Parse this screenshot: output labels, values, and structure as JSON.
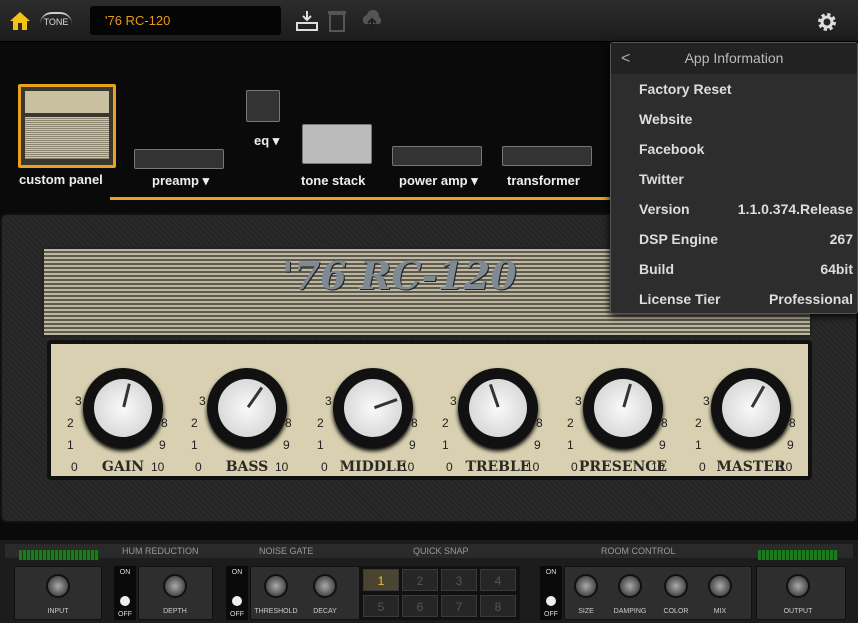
{
  "topbar": {
    "preset_name": "'76 RC-120",
    "tone_logo": "TONE",
    "icons": [
      "home-icon",
      "tonecloud-logo",
      "save-icon",
      "trash-icon",
      "cloud-upload-icon",
      "gear-icon"
    ],
    "accent": "#e9a21c"
  },
  "chain": {
    "modules": [
      {
        "label": "custom panel",
        "selected": true
      },
      {
        "label": "preamp",
        "dropdown": true
      },
      {
        "label": "eq",
        "dropdown": true
      },
      {
        "label": "tone stack"
      },
      {
        "label": "power amp",
        "dropdown": true
      },
      {
        "label": "transformer"
      }
    ]
  },
  "amp": {
    "name": "'76 RC-120",
    "scale": [
      "0",
      "1",
      "2",
      "3",
      "4",
      "5",
      "6",
      "7",
      "8",
      "9",
      "10"
    ],
    "knobs": [
      {
        "label": "GAIN",
        "value": 5.5
      },
      {
        "label": "BASS",
        "value": 6.3
      },
      {
        "label": "MIDDLE",
        "value": 7.6
      },
      {
        "label": "TREBLE",
        "value": 4.3
      },
      {
        "label": "PRESENCE",
        "value": 5.6
      },
      {
        "label": "MASTER",
        "value": 6.1
      }
    ]
  },
  "menu": {
    "title": "App Information",
    "items": [
      {
        "label": "Factory Reset",
        "value": ""
      },
      {
        "label": "Website",
        "value": ""
      },
      {
        "label": "Facebook",
        "value": ""
      },
      {
        "label": "Twitter",
        "value": ""
      },
      {
        "label": "Version",
        "value": "1.1.0.374.Release"
      },
      {
        "label": "DSP Engine",
        "value": "267"
      },
      {
        "label": "Build",
        "value": "64bit"
      },
      {
        "label": "License Tier",
        "value": "Professional"
      }
    ]
  },
  "bottom": {
    "sections": [
      "HUM REDUCTION",
      "NOISE GATE",
      "QUICK SNAP",
      "ROOM CONTROL"
    ],
    "on": "ON",
    "off": "OFF",
    "input": "INPUT",
    "depth": "DEPTH",
    "threshold": "THRESHOLD",
    "decay": "DECAY",
    "size": "SIZE",
    "damping": "DAMPING",
    "color": "COLOR",
    "mix": "MIX",
    "output": "OUTPUT",
    "snaps": [
      "1",
      "2",
      "3",
      "4",
      "5",
      "6",
      "7",
      "8"
    ],
    "active_snap": "1"
  }
}
